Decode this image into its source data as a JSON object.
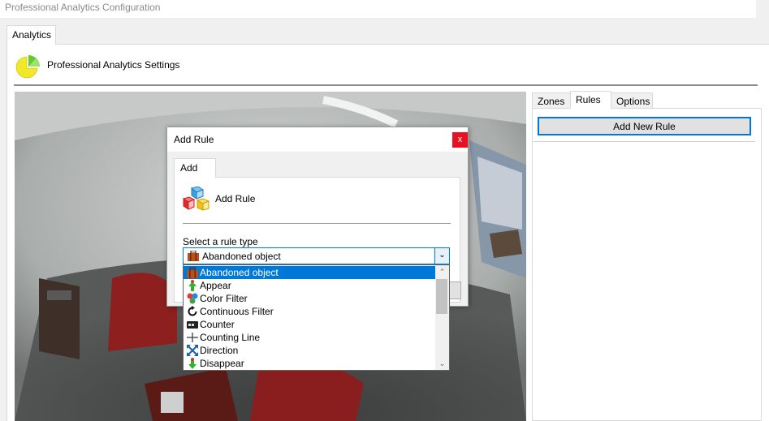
{
  "window": {
    "title": "Professional Analytics Configuration"
  },
  "main_tabs": [
    {
      "label": "Analytics",
      "active": true
    }
  ],
  "header": {
    "title": "Professional Analytics Settings",
    "icon": "pie-chart-icon"
  },
  "right_panel": {
    "tabs": [
      {
        "label": "Zones",
        "active": false
      },
      {
        "label": "Rules",
        "active": true
      },
      {
        "label": "Options",
        "active": false
      }
    ],
    "add_button_label": "Add New Rule"
  },
  "dialog": {
    "title": "Add Rule",
    "close_glyph": "x",
    "tab_label": "Add",
    "heading": "Add Rule",
    "heading_icon": "cubes-icon",
    "rule_type_label": "Select a rule type",
    "selected_rule": "Abandoned object",
    "rule_options": [
      {
        "label": "Abandoned object",
        "icon": "suitcase-icon",
        "selected": true
      },
      {
        "label": "Appear",
        "icon": "appear-arrow-icon",
        "selected": false
      },
      {
        "label": "Color Filter",
        "icon": "color-dots-icon",
        "selected": false
      },
      {
        "label": "Continuous Filter",
        "icon": "circular-arrow-icon",
        "selected": false
      },
      {
        "label": "Counter",
        "icon": "counter-icon",
        "selected": false
      },
      {
        "label": "Counting Line",
        "icon": "counting-line-icon",
        "selected": false
      },
      {
        "label": "Direction",
        "icon": "direction-arrows-icon",
        "selected": false
      },
      {
        "label": "Disappear",
        "icon": "disappear-arrow-icon",
        "selected": false
      }
    ]
  },
  "colors": {
    "accent": "#0078d7",
    "close_red": "#e81123",
    "selection": "#0078d7"
  }
}
